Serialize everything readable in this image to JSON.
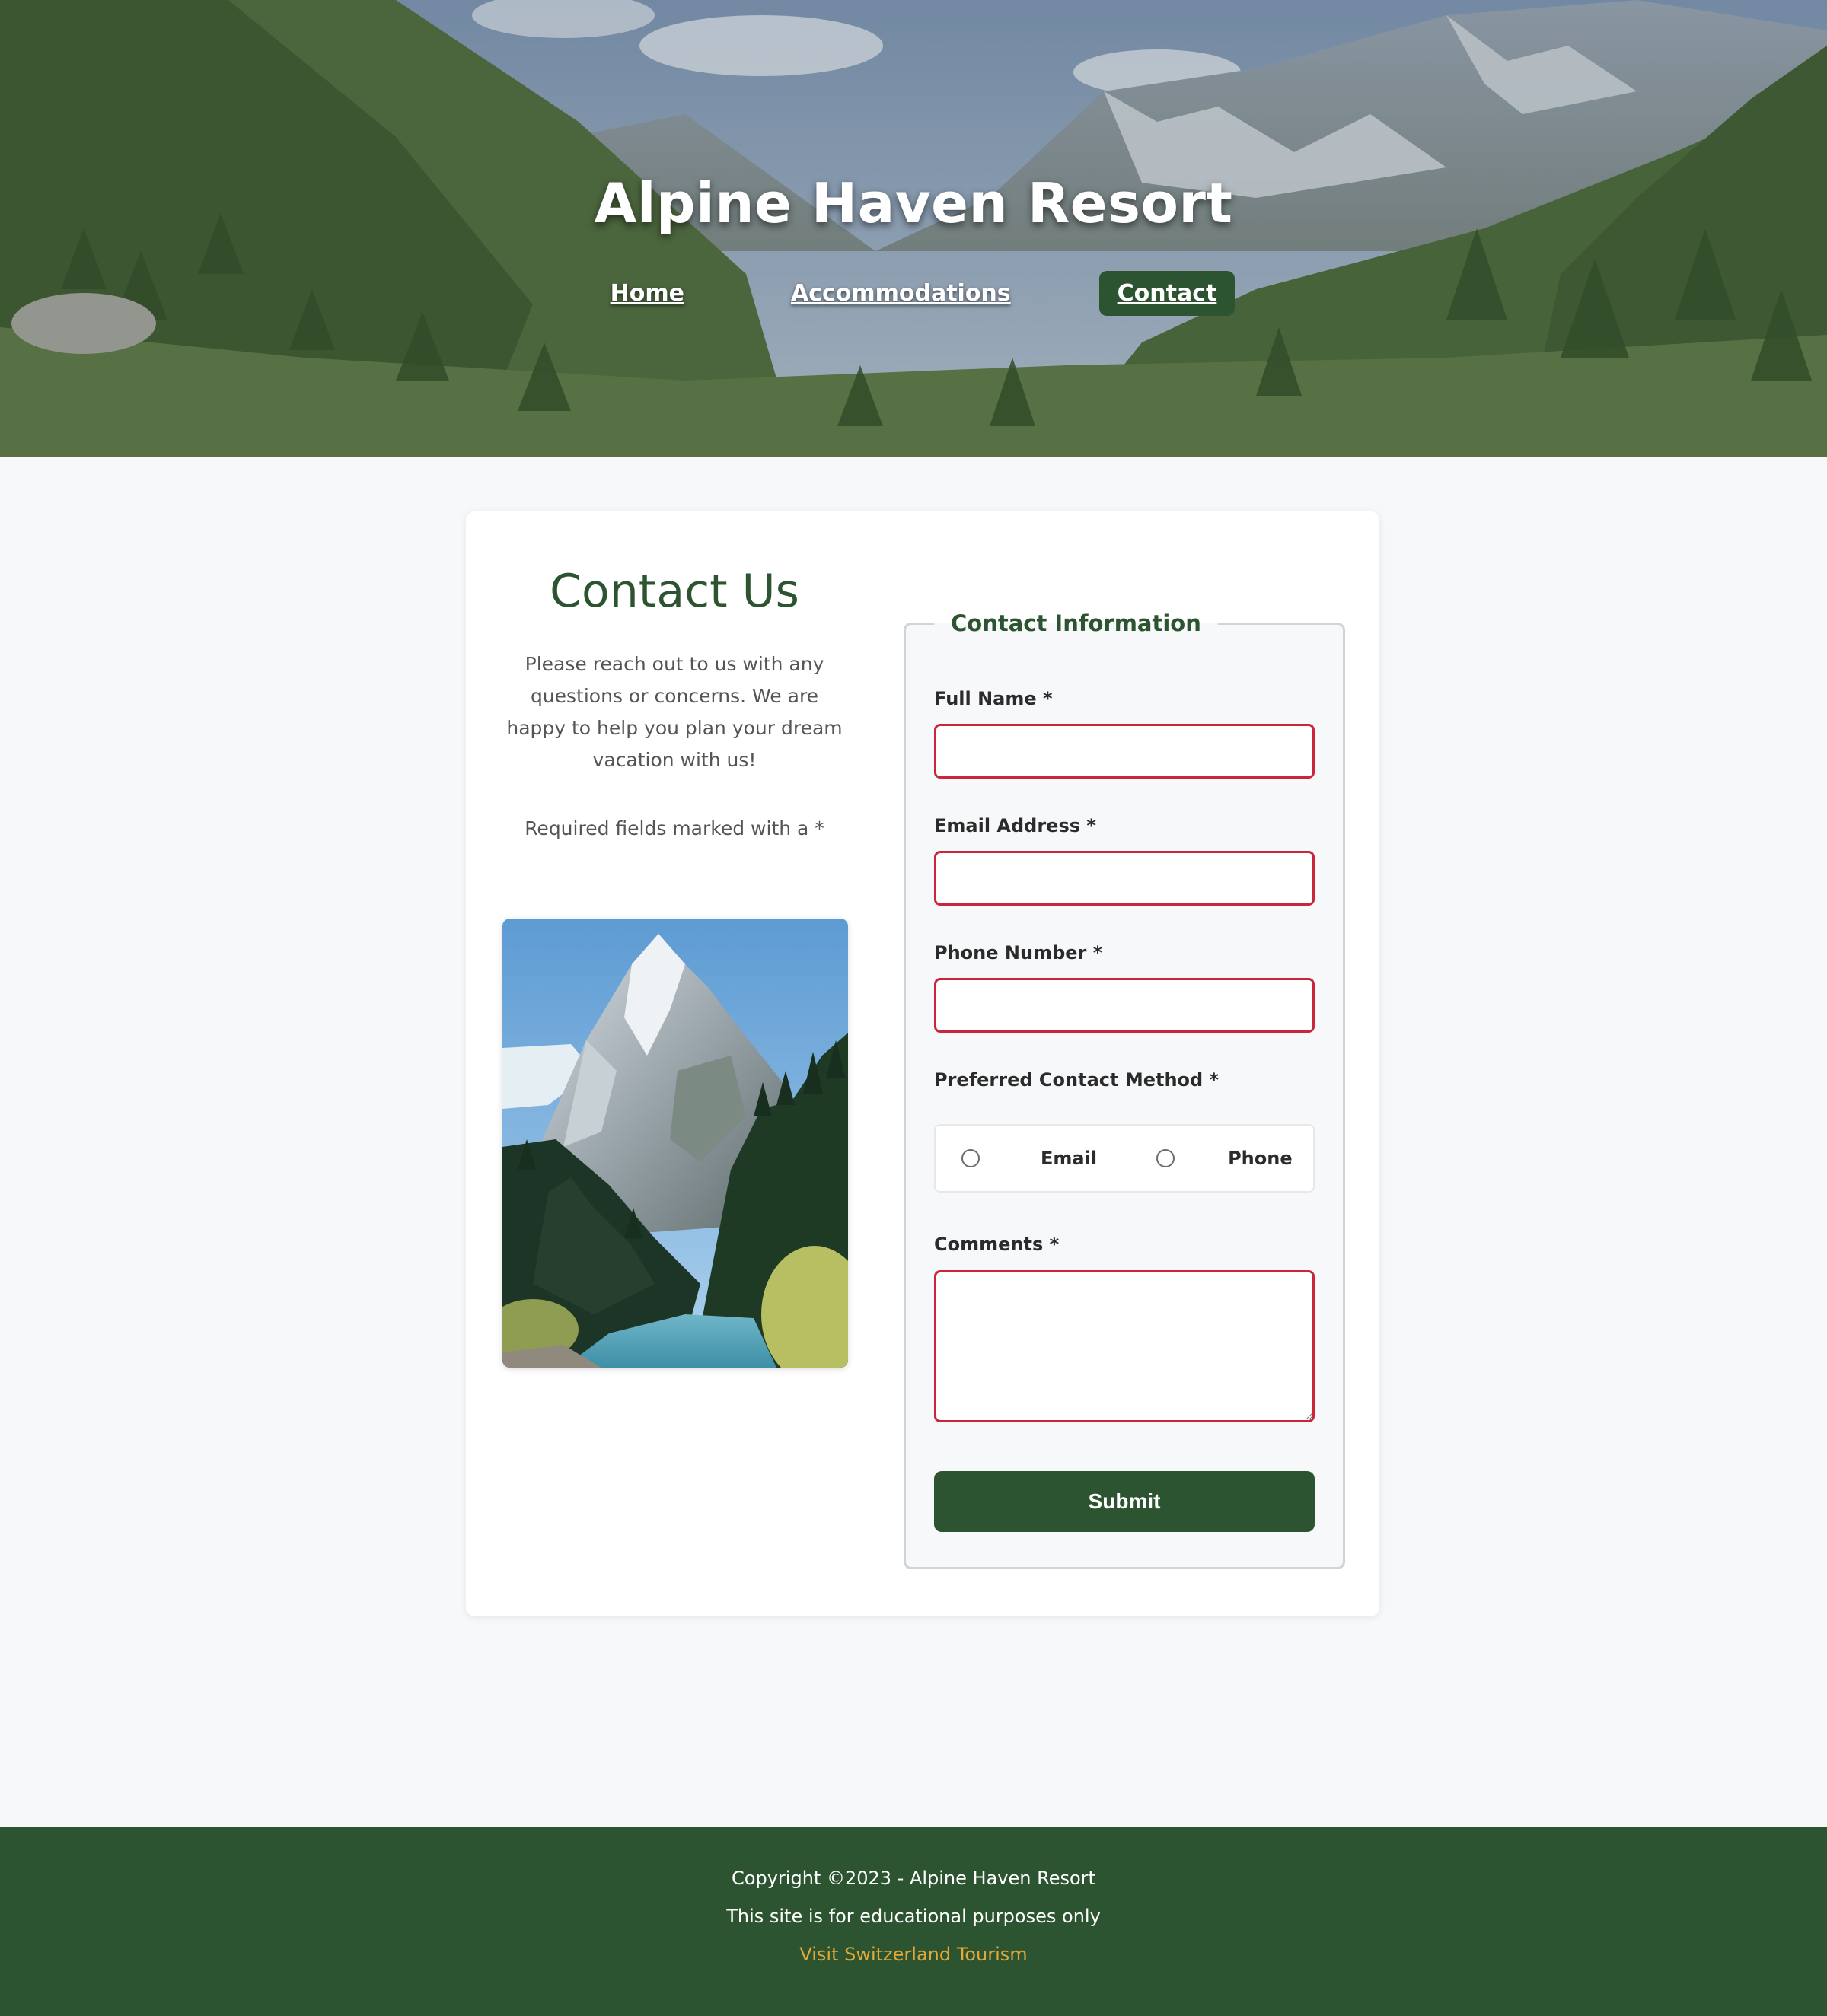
{
  "site": {
    "title": "Alpine Haven Resort"
  },
  "nav": {
    "items": [
      {
        "label": "Home",
        "active": false
      },
      {
        "label": "Accommodations",
        "active": false
      },
      {
        "label": "Contact",
        "active": true
      }
    ]
  },
  "intro": {
    "heading": "Contact Us",
    "description": "Please reach out to us with any questions or concerns. We are happy to help you plan your dream vacation with us!",
    "required_note": "Required fields marked with a *"
  },
  "form": {
    "legend": "Contact Information",
    "full_name_label": "Full Name *",
    "full_name_value": "",
    "email_label": "Email Address *",
    "email_value": "",
    "phone_label": "Phone Number *",
    "phone_value": "",
    "contact_method_label": "Preferred Contact Method *",
    "contact_method_options": [
      "Email",
      "Phone"
    ],
    "comments_label": "Comments *",
    "comments_value": "",
    "submit_label": "Submit"
  },
  "footer": {
    "copyright": "Copyright ©2023 - Alpine Haven Resort",
    "disclaimer": "This site is for educational purposes only",
    "link_label": "Visit Switzerland Tourism"
  },
  "colors": {
    "brand_green": "#2d5430",
    "error_red": "#c9263b",
    "link_gold": "#e0a93a"
  }
}
